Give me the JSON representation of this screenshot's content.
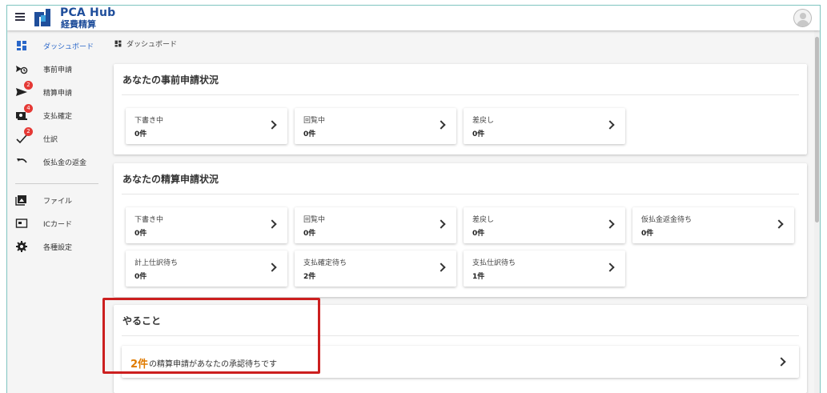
{
  "header": {
    "brand_title": "PCA Hub",
    "brand_subtitle": "経費精算",
    "brand_color": "#1f4e9b"
  },
  "breadcrumb": {
    "label": "ダッシュボード"
  },
  "sidebar": {
    "items": [
      {
        "label": "ダッシュボード",
        "icon": "dashboard-icon",
        "active": true
      },
      {
        "label": "事前申請",
        "icon": "pre-application-icon"
      },
      {
        "label": "精算申請",
        "icon": "send-icon",
        "badge": "2"
      },
      {
        "label": "支払確定",
        "icon": "payment-icon",
        "badge": "4"
      },
      {
        "label": "仕訳",
        "icon": "check-icon",
        "badge": "2"
      },
      {
        "label": "仮払金の返金",
        "icon": "undo-icon"
      },
      {
        "label": "ファイル",
        "icon": "image-file-icon"
      },
      {
        "label": "ICカード",
        "icon": "ic-card-icon"
      },
      {
        "label": "各種設定",
        "icon": "gear-icon"
      }
    ]
  },
  "pre_application_status": {
    "title": "あなたの事前申請状況",
    "cards": [
      {
        "label": "下書き中",
        "value": "0件"
      },
      {
        "label": "回覧中",
        "value": "0件"
      },
      {
        "label": "差戻し",
        "value": "0件"
      }
    ]
  },
  "settlement_status": {
    "title": "あなたの精算申請状況",
    "cards": [
      {
        "label": "下書き中",
        "value": "0件"
      },
      {
        "label": "回覧中",
        "value": "0件"
      },
      {
        "label": "差戻し",
        "value": "0件"
      },
      {
        "label": "仮払金返金待ち",
        "value": "0件"
      },
      {
        "label": "計上仕訳待ち",
        "value": "0件"
      },
      {
        "label": "支払確定待ち",
        "value": "2件"
      },
      {
        "label": "支払仕訳待ち",
        "value": "1件"
      }
    ]
  },
  "todo": {
    "title": "やること",
    "count": "2件",
    "message": "の精算申請があなたの承認待ちです"
  },
  "colors": {
    "accent": "#2a67c9",
    "badge": "#e53935",
    "todo_count": "#e07b00",
    "highlight_border": "#cc1f1f"
  }
}
